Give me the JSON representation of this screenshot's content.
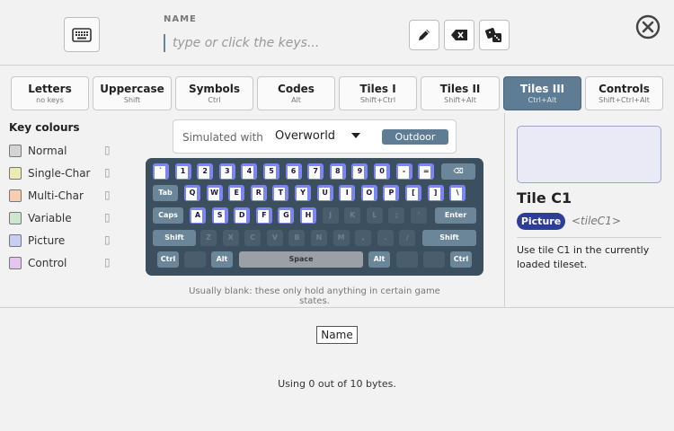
{
  "header": {
    "name_label": "NAME",
    "name_placeholder": "type or click the keys...",
    "icons": {
      "keyboard": "keyboard-icon",
      "edit": "pencil-icon",
      "backspace": "backspace-icon",
      "random": "dice-icon",
      "close": "close-icon"
    }
  },
  "tabs": [
    {
      "label": "Letters",
      "hint": "no keys"
    },
    {
      "label": "Uppercase",
      "hint": "Shift"
    },
    {
      "label": "Symbols",
      "hint": "Ctrl"
    },
    {
      "label": "Codes",
      "hint": "Alt"
    },
    {
      "label": "Tiles I",
      "hint": "Shift+Ctrl"
    },
    {
      "label": "Tiles II",
      "hint": "Shift+Alt"
    },
    {
      "label": "Tiles III",
      "hint": "Ctrl+Alt",
      "active": true
    },
    {
      "label": "Controls",
      "hint": "Shift+Ctrl+Alt"
    }
  ],
  "legend": {
    "title": "Key colours",
    "items": [
      {
        "label": "Normal",
        "color": "#d4d4d4"
      },
      {
        "label": "Single-Char",
        "color": "#ecebb4"
      },
      {
        "label": "Multi-Char",
        "color": "#f7cfb0"
      },
      {
        "label": "Variable",
        "color": "#cde7cf"
      },
      {
        "label": "Picture",
        "color": "#c8cdf6"
      },
      {
        "label": "Control",
        "color": "#e3c6ee"
      }
    ],
    "glyph": "▯"
  },
  "simulation": {
    "label": "Simulated with",
    "selected": "Overworld",
    "badge": "Outdoor"
  },
  "keyboard": {
    "row1": [
      "`",
      "1",
      "2",
      "3",
      "4",
      "5",
      "6",
      "7",
      "8",
      "9",
      "0",
      "-",
      "="
    ],
    "backspace": "⌫",
    "tab": "Tab",
    "row2": [
      "Q",
      "W",
      "E",
      "R",
      "T",
      "Y",
      "U",
      "I",
      "O",
      "P",
      "[",
      "]",
      "\\"
    ],
    "caps": "Caps",
    "row3": [
      "A",
      "S",
      "D",
      "F",
      "G",
      "H",
      "J",
      "K",
      "L",
      ";",
      "'"
    ],
    "enter": "Enter",
    "shift_left": "Shift",
    "row4": [
      "Z",
      "X",
      "C",
      "V",
      "B",
      "N",
      "M",
      ",",
      ".",
      "/"
    ],
    "shift_right": "Shift",
    "ctrl_left": "Ctrl",
    "alt_left": "Alt",
    "space": "Space",
    "alt_right": "Alt",
    "ctrl_right": "Ctrl",
    "note": "Usually blank: these only hold anything in certain game states."
  },
  "detail": {
    "title": "Tile C1",
    "badge": "Picture",
    "code": "<tileC1>",
    "description": "Use tile C1 in the currently loaded tileset."
  },
  "footer": {
    "name_chip": "Name",
    "bytes_text": "Using 0 out of 10 bytes."
  }
}
